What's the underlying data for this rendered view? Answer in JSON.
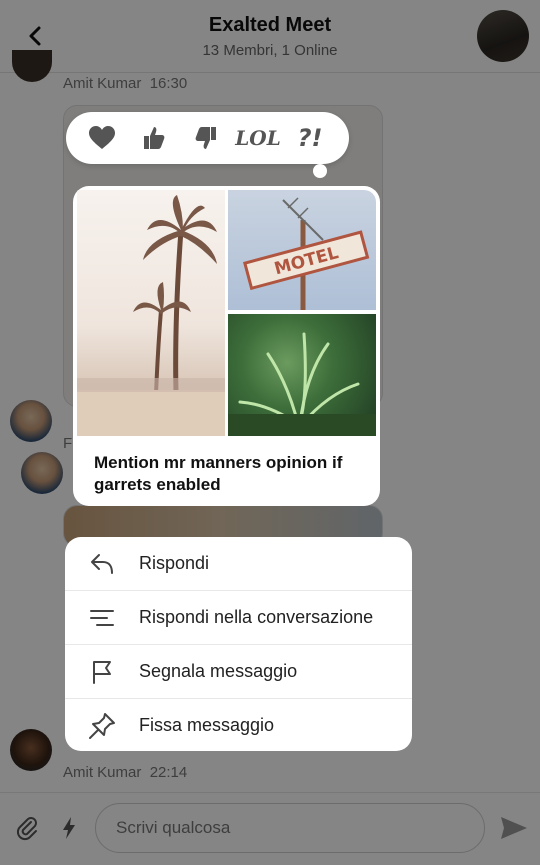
{
  "header": {
    "title": "Exalted Meet",
    "subtitle": "13 Membri, 1 Online"
  },
  "chat": {
    "top_meta": {
      "author": "Amit Kumar",
      "time": "16:30"
    },
    "partial_initial": "F",
    "bottom_meta": {
      "author": "Amit Kumar",
      "time": "22:14"
    }
  },
  "reactions": {
    "lol": "LOL",
    "confused": "?!"
  },
  "focused_message": {
    "text": "Mention mr manners opinion if garrets enabled"
  },
  "context_menu": {
    "items": [
      {
        "label": "Rispondi",
        "icon": "reply-icon"
      },
      {
        "label": "Rispondi nella conversazione",
        "icon": "thread-reply-icon"
      },
      {
        "label": "Segnala messaggio",
        "icon": "flag-icon"
      },
      {
        "label": "Fissa messaggio",
        "icon": "pin-icon"
      }
    ]
  },
  "composer": {
    "placeholder": "Scrivi qualcosa"
  }
}
